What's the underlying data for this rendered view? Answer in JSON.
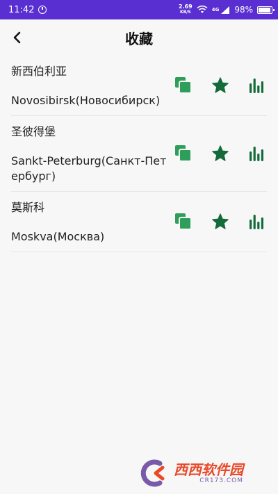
{
  "status_bar": {
    "time": "11:42",
    "net_speed": "2.69",
    "net_unit": "KB/S",
    "signal_tag": "4G",
    "battery": "98%"
  },
  "header": {
    "title": "收藏"
  },
  "favorites": [
    {
      "name_cn": "新西伯利亚",
      "name_en": "Novosibirsk(Новосибирск)"
    },
    {
      "name_cn": "圣彼得堡",
      "name_en": "Sankt-Peterburg(Санкт-Петербург)"
    },
    {
      "name_cn": "莫斯科",
      "name_en": "Moskva(Москва)"
    }
  ],
  "colors": {
    "status_bar": "#5a2fd1",
    "copy_icon": "#2e9e5b",
    "star_icon": "#146b3a",
    "chart_icon": "#146b3a"
  },
  "icons": {
    "back": "chevron-left-icon",
    "copy": "copy-icon",
    "star": "star-icon",
    "chart": "bar-chart-icon"
  },
  "watermark": {
    "main": "西西软件园",
    "sub": "CR173.COM"
  }
}
